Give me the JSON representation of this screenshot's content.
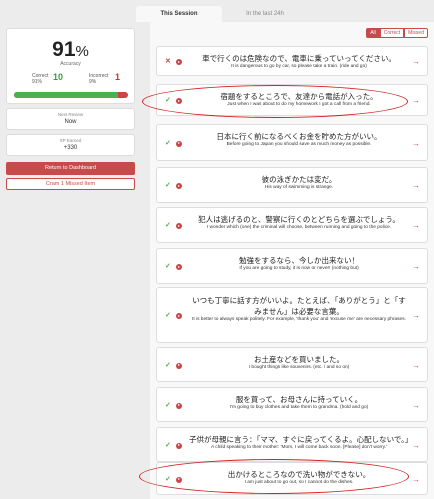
{
  "tabs": [
    {
      "label": "This Session",
      "active": true
    },
    {
      "label": "In the last 24h",
      "active": false
    }
  ],
  "summary": {
    "accuracy_value": "91",
    "accuracy_sign": "%",
    "accuracy_label": "Accuracy",
    "correct_label": "Correct",
    "correct_pct": "91%",
    "correct_count": "10",
    "incorrect_label": "Incorrect",
    "incorrect_pct": "9%",
    "incorrect_count": "1",
    "progress_fraction": 0.91
  },
  "next_review": {
    "label": "Next Review",
    "value": "Now"
  },
  "xp": {
    "label": "XP Earned",
    "value": "+330"
  },
  "buttons": {
    "dashboard": "Return to Dashboard",
    "cram": "Cram 1 Missed Item"
  },
  "filters": [
    {
      "label": "All",
      "active": true
    },
    {
      "label": "Correct",
      "active": false
    },
    {
      "label": "Missed",
      "active": false
    }
  ],
  "items": [
    {
      "status": "incorrect",
      "mark": "✕",
      "jp": "車で行くのは危険なので、電車に乗っていってください。",
      "en": "It is dangerous to go by car, so please take a train. (ride and go)"
    },
    {
      "status": "correct",
      "mark": "✓",
      "jp": "宿題をするところで、友達から電話が入った。",
      "en": "Just when I was about to do my homework I got a call from a friend."
    },
    {
      "status": "correct",
      "mark": "✓",
      "jp": "日本に行く前になるべくお金を貯めた方がいい。",
      "en": "Before going to Japan you should save as much money as possible."
    },
    {
      "status": "correct",
      "mark": "✓",
      "jp": "彼の泳ぎかたは変だ。",
      "en": "His way of swimming is strange."
    },
    {
      "status": "correct",
      "mark": "✓",
      "jp": "犯人は逃げるのと、警察に行くのとどちらを選ぶでしょう。",
      "en": "I wonder which (one) the criminal will choose, between running and going to the police."
    },
    {
      "status": "correct",
      "mark": "✓",
      "jp": "勉強をするなら、今しか出来ない！",
      "en": "If you are going to study, it is now or never! (nothing but)"
    },
    {
      "status": "correct",
      "mark": "✓",
      "jp": "いつも丁寧に話す方がいいよ。たとえば、「ありがとう」と「すみません」は必要な言葉。",
      "en": "It is better to always speak politely. For example, 'thank you' and 'excuse me' are necessary phrases."
    },
    {
      "status": "correct",
      "mark": "✓",
      "jp": "お土産などを買いました。",
      "en": "I bought things like souvenirs. (etc. / and so on)"
    },
    {
      "status": "correct",
      "mark": "✓",
      "jp": "服を買って、お母さんに持っていく。",
      "en": "I'm going to buy clothes and take them to grandma. (hold and go)"
    },
    {
      "status": "correct",
      "mark": "✓",
      "jp": "子供が母親に言う：「ママ、すぐに戻ってくるよ。心配しないで。」",
      "en": "A child speaking to their mother: 'Mom, I will come back soon. [Please] don't worry.'"
    },
    {
      "status": "correct",
      "mark": "✓",
      "jp": "出かけるところなので洗い物ができない。",
      "en": "I am just about to go out, so I cannot do the dishes."
    }
  ]
}
